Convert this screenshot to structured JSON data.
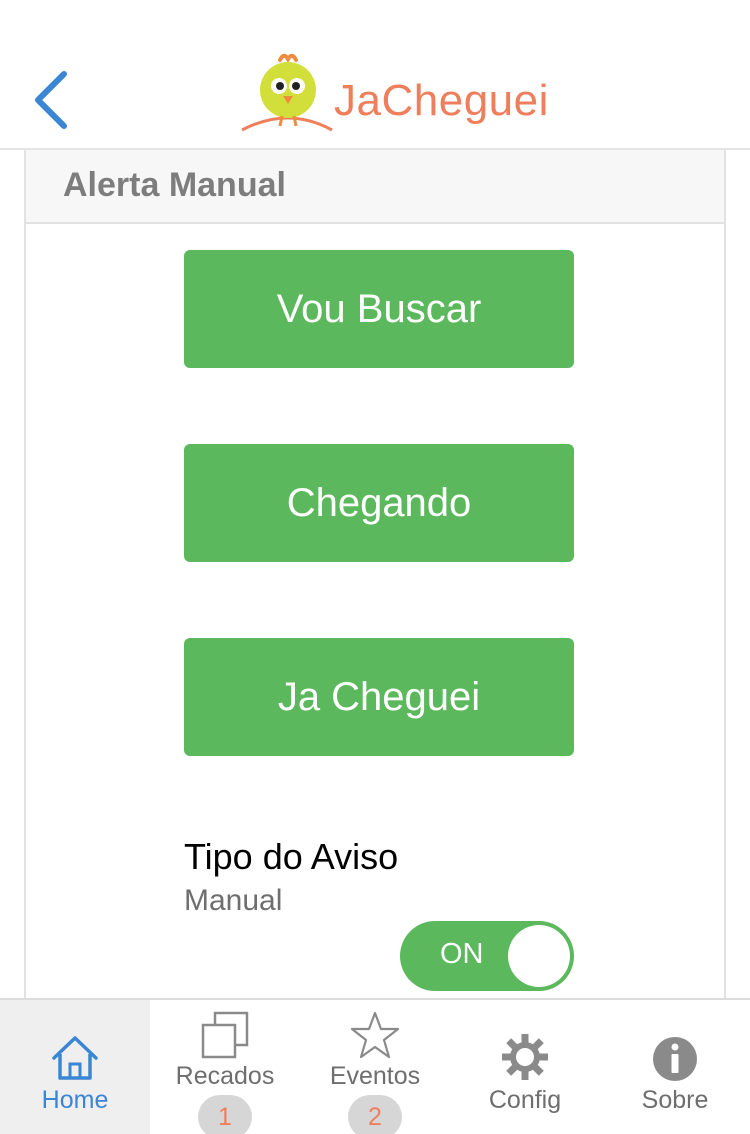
{
  "header": {
    "title": "JaCheguei",
    "back_icon": "chevron-left-icon",
    "logo_icon": "chick-logo-icon"
  },
  "panel": {
    "title": "Alerta Manual",
    "buttons": [
      {
        "label": "Vou Buscar"
      },
      {
        "label": "Chegando"
      },
      {
        "label": "Ja Cheguei"
      }
    ],
    "aviso": {
      "label": "Tipo do Aviso",
      "value": "Manual",
      "toggle_label": "ON",
      "toggle_on": true
    }
  },
  "tabbar": {
    "tabs": [
      {
        "label": "Home",
        "icon": "home-icon",
        "active": true
      },
      {
        "label": "Recados",
        "icon": "copy-icon",
        "badge": "1"
      },
      {
        "label": "Eventos",
        "icon": "star-icon",
        "badge": "2"
      },
      {
        "label": "Config",
        "icon": "gear-icon"
      },
      {
        "label": "Sobre",
        "icon": "info-icon"
      }
    ]
  },
  "colors": {
    "accent_green": "#5cb85c",
    "brand_orange": "#ef7f5c",
    "active_blue": "#3a86d4"
  }
}
